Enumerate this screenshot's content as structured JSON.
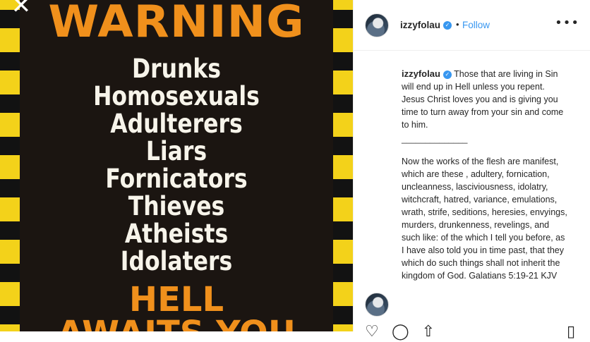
{
  "image": {
    "warning_title": "WARNING",
    "list": [
      "Drunks",
      "Homosexuals",
      "Adulterers",
      "Liars",
      "Fornicators",
      "Thieves",
      "Atheists",
      "Idolaters"
    ],
    "hell_title": "HELL",
    "awaits_title": "AWAITS YOU",
    "close_symbol": "✕"
  },
  "header": {
    "username": "izzyfolau",
    "verified_symbol": "✓",
    "separator": "•",
    "follow_label": "Follow",
    "more_symbol": "•••"
  },
  "caption": {
    "username": "izzyfolau",
    "verified_symbol": "✓",
    "text1": "Those that are living in Sin will end up in Hell unless you repent. Jesus Christ loves you and is giving you time to turn away from your sin and come to him.",
    "rule": "______________",
    "text2": "Now the works of the flesh are manifest, which are these , adultery, fornication, uncleanness, lasciviousness, idolatry, witchcraft, hatred, variance, emulations, wrath, strife, seditions, heresies, envyings, murders, drunkenness, revelings, and such like: of the which I tell you before, as I have also told you in time past, that they which do such things shall not inherit the kingdom of God. Galatians 5:19-21 KJV"
  },
  "actions": {
    "like_icon": "♡",
    "comment_icon": "◯",
    "share_icon": "⇧",
    "save_icon": "▯"
  },
  "colors": {
    "accent": "#3897f0",
    "sign_orange": "#f0901c",
    "stripe_yellow": "#f3d21a"
  }
}
